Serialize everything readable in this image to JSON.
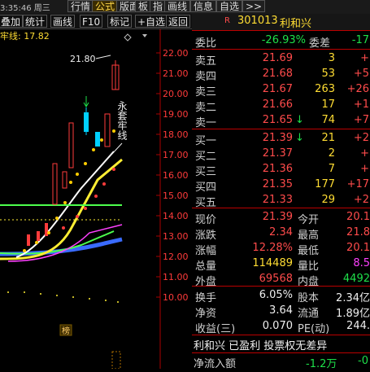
{
  "topbar": {
    "time": "3:35:46 周三",
    "buttons": [
      "行情",
      "公式",
      "版面",
      "板",
      "指",
      "画线",
      "信息",
      "自选",
      ">>"
    ],
    "active": "公式"
  },
  "toolbar": {
    "buttons": [
      "叠加",
      "统计",
      "画线",
      "F10",
      "标记",
      "+自选",
      "返回"
    ],
    "indicator_label": "牢线: 17.82"
  },
  "chart": {
    "y_ticks": [
      "22.00",
      "21.00",
      "20.00",
      "19.00",
      "18.00",
      "17.00",
      "16.00",
      "15.00",
      "14.00",
      "13.00",
      "12.00",
      "11.00",
      "10.00"
    ],
    "peak_label": "21.80",
    "annotation": "永套牢线",
    "bottom_label": "榜",
    "colors": {
      "up": "#ff3b3b",
      "down": "#00d0ff",
      "ma_yellow": "#ffee33",
      "ma_white": "#ffffff",
      "ma_green": "#4dff4d",
      "ma_blue": "#3a6bff",
      "dots": "#ffcc00"
    }
  },
  "quote": {
    "header": {
      "badge": "R",
      "code": "301013",
      "name": "利和兴"
    },
    "webi": {
      "label": "委比",
      "value": "-26.93%",
      "label2": "委差",
      "value2": "-17"
    },
    "sell": [
      {
        "label": "卖五",
        "price": "21.69",
        "vol": "3",
        "chg": "+"
      },
      {
        "label": "卖四",
        "price": "21.68",
        "vol": "53",
        "chg": "+5"
      },
      {
        "label": "卖三",
        "price": "21.67",
        "vol": "263",
        "chg": "+26"
      },
      {
        "label": "卖二",
        "price": "21.66",
        "vol": "17",
        "chg": "+1"
      },
      {
        "label": "卖一",
        "price": "21.65",
        "vol": "74",
        "chg": "+7",
        "arrow": "↓"
      }
    ],
    "buy": [
      {
        "label": "买一",
        "price": "21.39",
        "vol": "21",
        "chg": "+2",
        "arrow": "↓"
      },
      {
        "label": "买二",
        "price": "21.37",
        "vol": "2",
        "chg": "+"
      },
      {
        "label": "买三",
        "price": "21.36",
        "vol": "7",
        "chg": "+"
      },
      {
        "label": "买四",
        "price": "21.35",
        "vol": "177",
        "chg": "+17"
      },
      {
        "label": "买五",
        "price": "21.33",
        "vol": "29",
        "chg": "+2"
      }
    ],
    "stats": [
      {
        "l1": "现价",
        "v1": "21.39",
        "l2": "今开",
        "v2": "20.1"
      },
      {
        "l1": "涨跌",
        "v1": "2.34",
        "l2": "最高",
        "v2": "21.8"
      },
      {
        "l1": "涨幅",
        "v1": "12.28%",
        "l2": "最低",
        "v2": "20.1"
      },
      {
        "l1": "总量",
        "v1": "114489",
        "l2": "量比",
        "v2": "8.5"
      },
      {
        "l1": "外盘",
        "v1": "69568",
        "l2": "内盘",
        "v2": "4492"
      }
    ],
    "stats2": [
      {
        "l1": "换手",
        "v1": "6.05%",
        "l2": "股本",
        "v2": "2.34亿"
      },
      {
        "l1": "净资",
        "v1": "3.64",
        "l2": "流通",
        "v2": "1.89亿"
      },
      {
        "l1": "收益(三)",
        "v1": "0.070",
        "l2": "PE(动)",
        "v2": "244."
      }
    ],
    "footer": {
      "desc": "利和兴 已盈利 投票权无差异",
      "flow_label": "净流入额",
      "flow_value": "-1.2万",
      "flow_value2": "-0"
    }
  }
}
